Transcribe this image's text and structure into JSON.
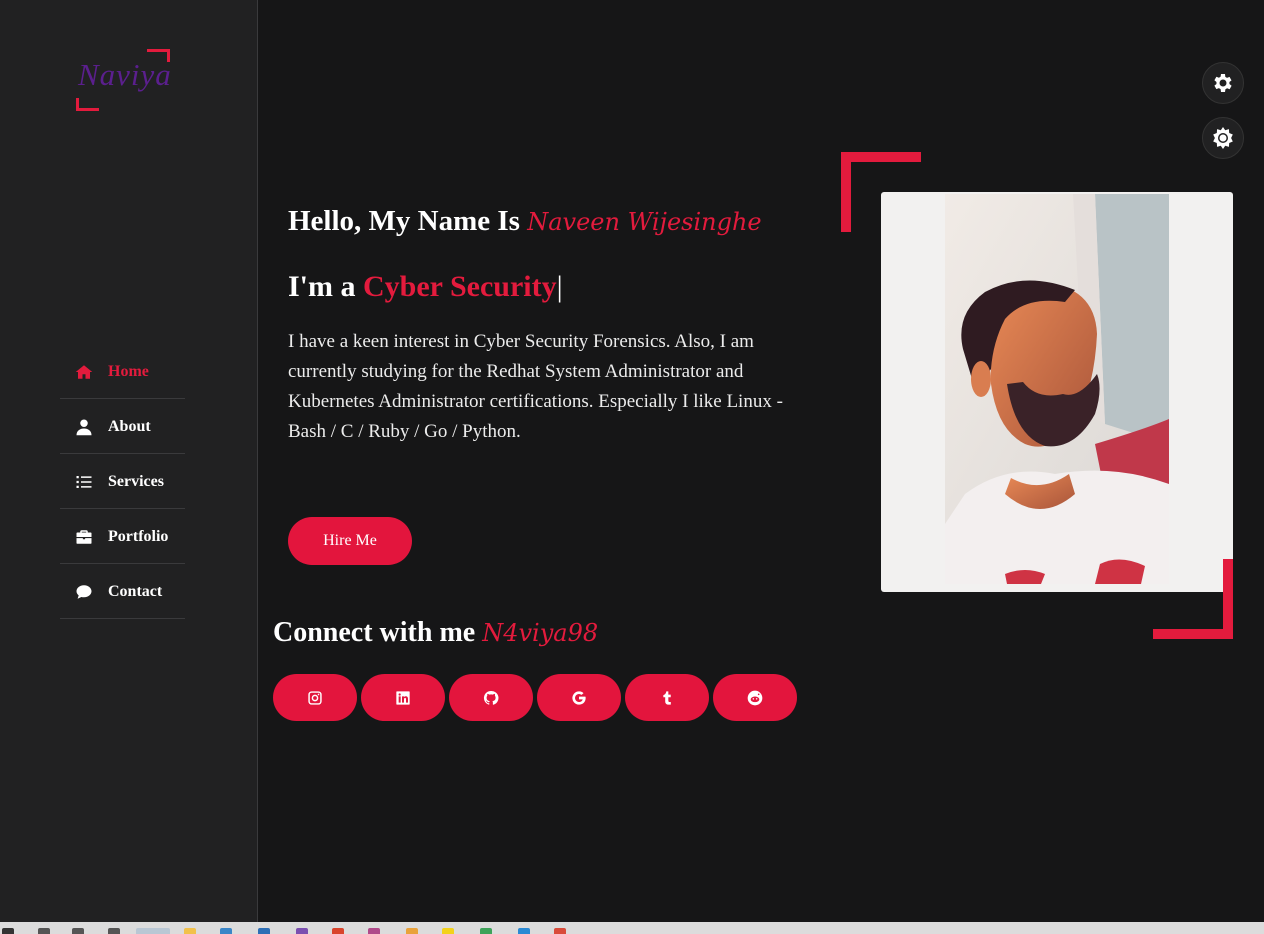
{
  "logo": {
    "text": "Naviya"
  },
  "nav": [
    {
      "label": "Home",
      "icon": "home-icon",
      "active": true
    },
    {
      "label": "About",
      "icon": "user-icon",
      "active": false
    },
    {
      "label": "Services",
      "icon": "list-icon",
      "active": false
    },
    {
      "label": "Portfolio",
      "icon": "briefcase-icon",
      "active": false
    },
    {
      "label": "Contact",
      "icon": "chat-icon",
      "active": false
    }
  ],
  "hero": {
    "hello_prefix": "Hello, My Name Is ",
    "name": "Naveen Wijesinghe",
    "role_prefix": "I'm a ",
    "role": "Cyber Security",
    "cursor": "|",
    "description": "I have a keen interest in Cyber Security Forensics. Also, I am currently studying for the Redhat System Administrator and Kubernetes Administrator certifications. Especially I like Linux - Bash / C / Ruby / Go / Python.",
    "hire_label": "Hire Me"
  },
  "connect": {
    "prefix": "Connect with me ",
    "handle": "N4viya98",
    "socials": [
      "instagram-icon",
      "linkedin-icon",
      "github-icon",
      "google-icon",
      "tumblr-icon",
      "reddit-icon"
    ]
  },
  "colors": {
    "accent": "#e31b3d",
    "background": "#161617",
    "sidebar": "#212122",
    "logo": "#5b1f8e"
  }
}
